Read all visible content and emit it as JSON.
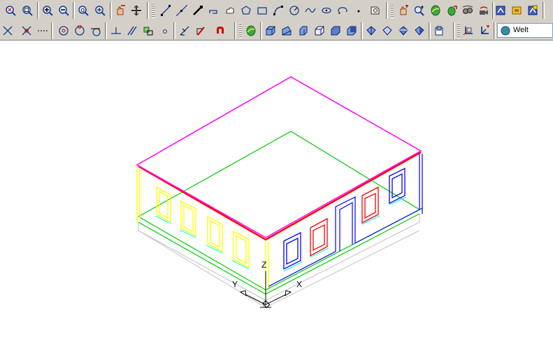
{
  "toolbar": {
    "ucs_combo_value": "Welt",
    "row1_icons": [
      "zoom-window-icon",
      "zoom-all-icon",
      "zoom-in-icon",
      "zoom-out-icon",
      "zoom-previous-icon",
      "zoom-extents-icon",
      "pan-realtime-icon",
      "pan-point-icon",
      "line-icon",
      "construction-line-icon",
      "polyline-icon",
      "3d-polyline-icon",
      "revision-cloud-icon",
      "polygon-icon",
      "rectangle-icon",
      "arc-icon",
      "circle-icon",
      "spline-icon",
      "ellipse-icon",
      "ellipse-arc-icon",
      "point-icon",
      "region-icon",
      "3d-orbit-icon",
      "zoom-realtime-icon",
      "sphere-globe-icon",
      "rotate-view-icon",
      "camera-icon",
      "swivel-icon",
      "properties-icon",
      "layer-icon",
      "match-properties-icon"
    ],
    "row2_icons": [
      "snap-endpoint-icon",
      "snap-intersection-icon",
      "snap-extension-icon",
      "snap-center-icon",
      "snap-quadrant-icon",
      "snap-tangent-icon",
      "snap-perpendicular-icon",
      "snap-parallel-icon",
      "snap-insert-icon",
      "snap-node-icon",
      "snap-nearest-icon",
      "snap-none-icon",
      "snap-settings-icon",
      "render-sphere-icon",
      "box-icon",
      "wedge-icon",
      "cone-icon",
      "cylinder-icon",
      "torus-icon",
      "pyramid-icon",
      "dish-icon",
      "dome-icon",
      "mesh-icon",
      "surface-icon",
      "ucs-icon",
      "ucs-origin-icon",
      "ucs-world-icon"
    ]
  },
  "viewport": {
    "ucs_z_label": "Z",
    "ucs_y_label": "Y",
    "ucs_x_label": "X",
    "colors": {
      "roof": "#ff00ff",
      "eave": "#ff0000",
      "floor": "#00cc00",
      "left_wall": "#ffff00",
      "right_wall": "#0000ff",
      "window_sill": "#00ffff",
      "base": "#c0c0c0",
      "ucs": "#000000"
    }
  }
}
